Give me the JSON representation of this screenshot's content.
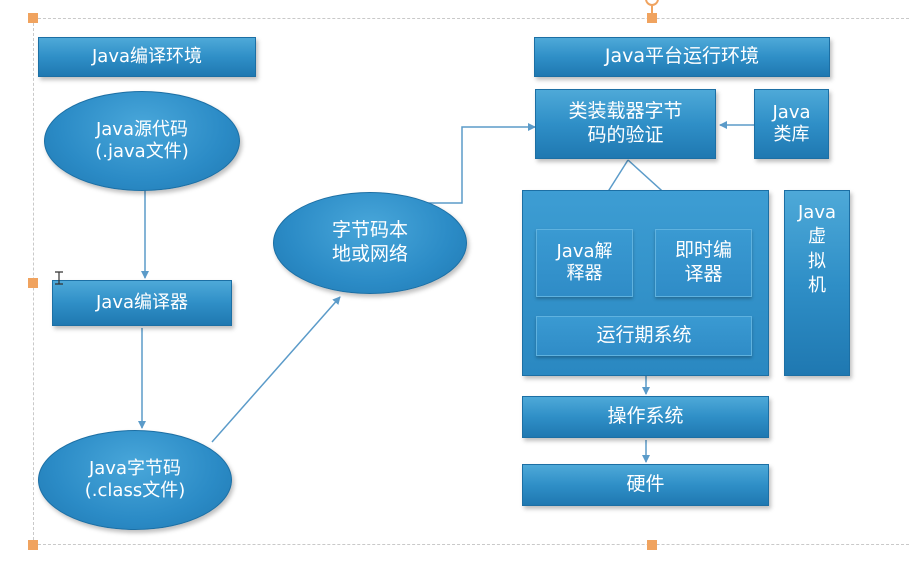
{
  "compile_env": {
    "title": "Java编译环境",
    "source_code": "Java源代码\n(.java文件)",
    "compiler": "Java编译器",
    "bytecode": "Java字节码\n(.class文件)"
  },
  "transport": {
    "label": "字节码本\n地或网络"
  },
  "runtime_env": {
    "title": "Java平台运行环境",
    "class_loader": "类装载器字节\n码的验证",
    "class_library": "Java\n类库",
    "interpreter": "Java解\n释器",
    "jit_compiler": "即时编\n译器",
    "runtime_system": "运行期系统",
    "jvm_label": "Java\n虚\n拟\n机",
    "os": "操作系统",
    "hardware": "硬件"
  },
  "colors": {
    "shape_fill": "#2f8fc7",
    "arrow": "#5b9bc9",
    "handle": "#f0a35f"
  }
}
